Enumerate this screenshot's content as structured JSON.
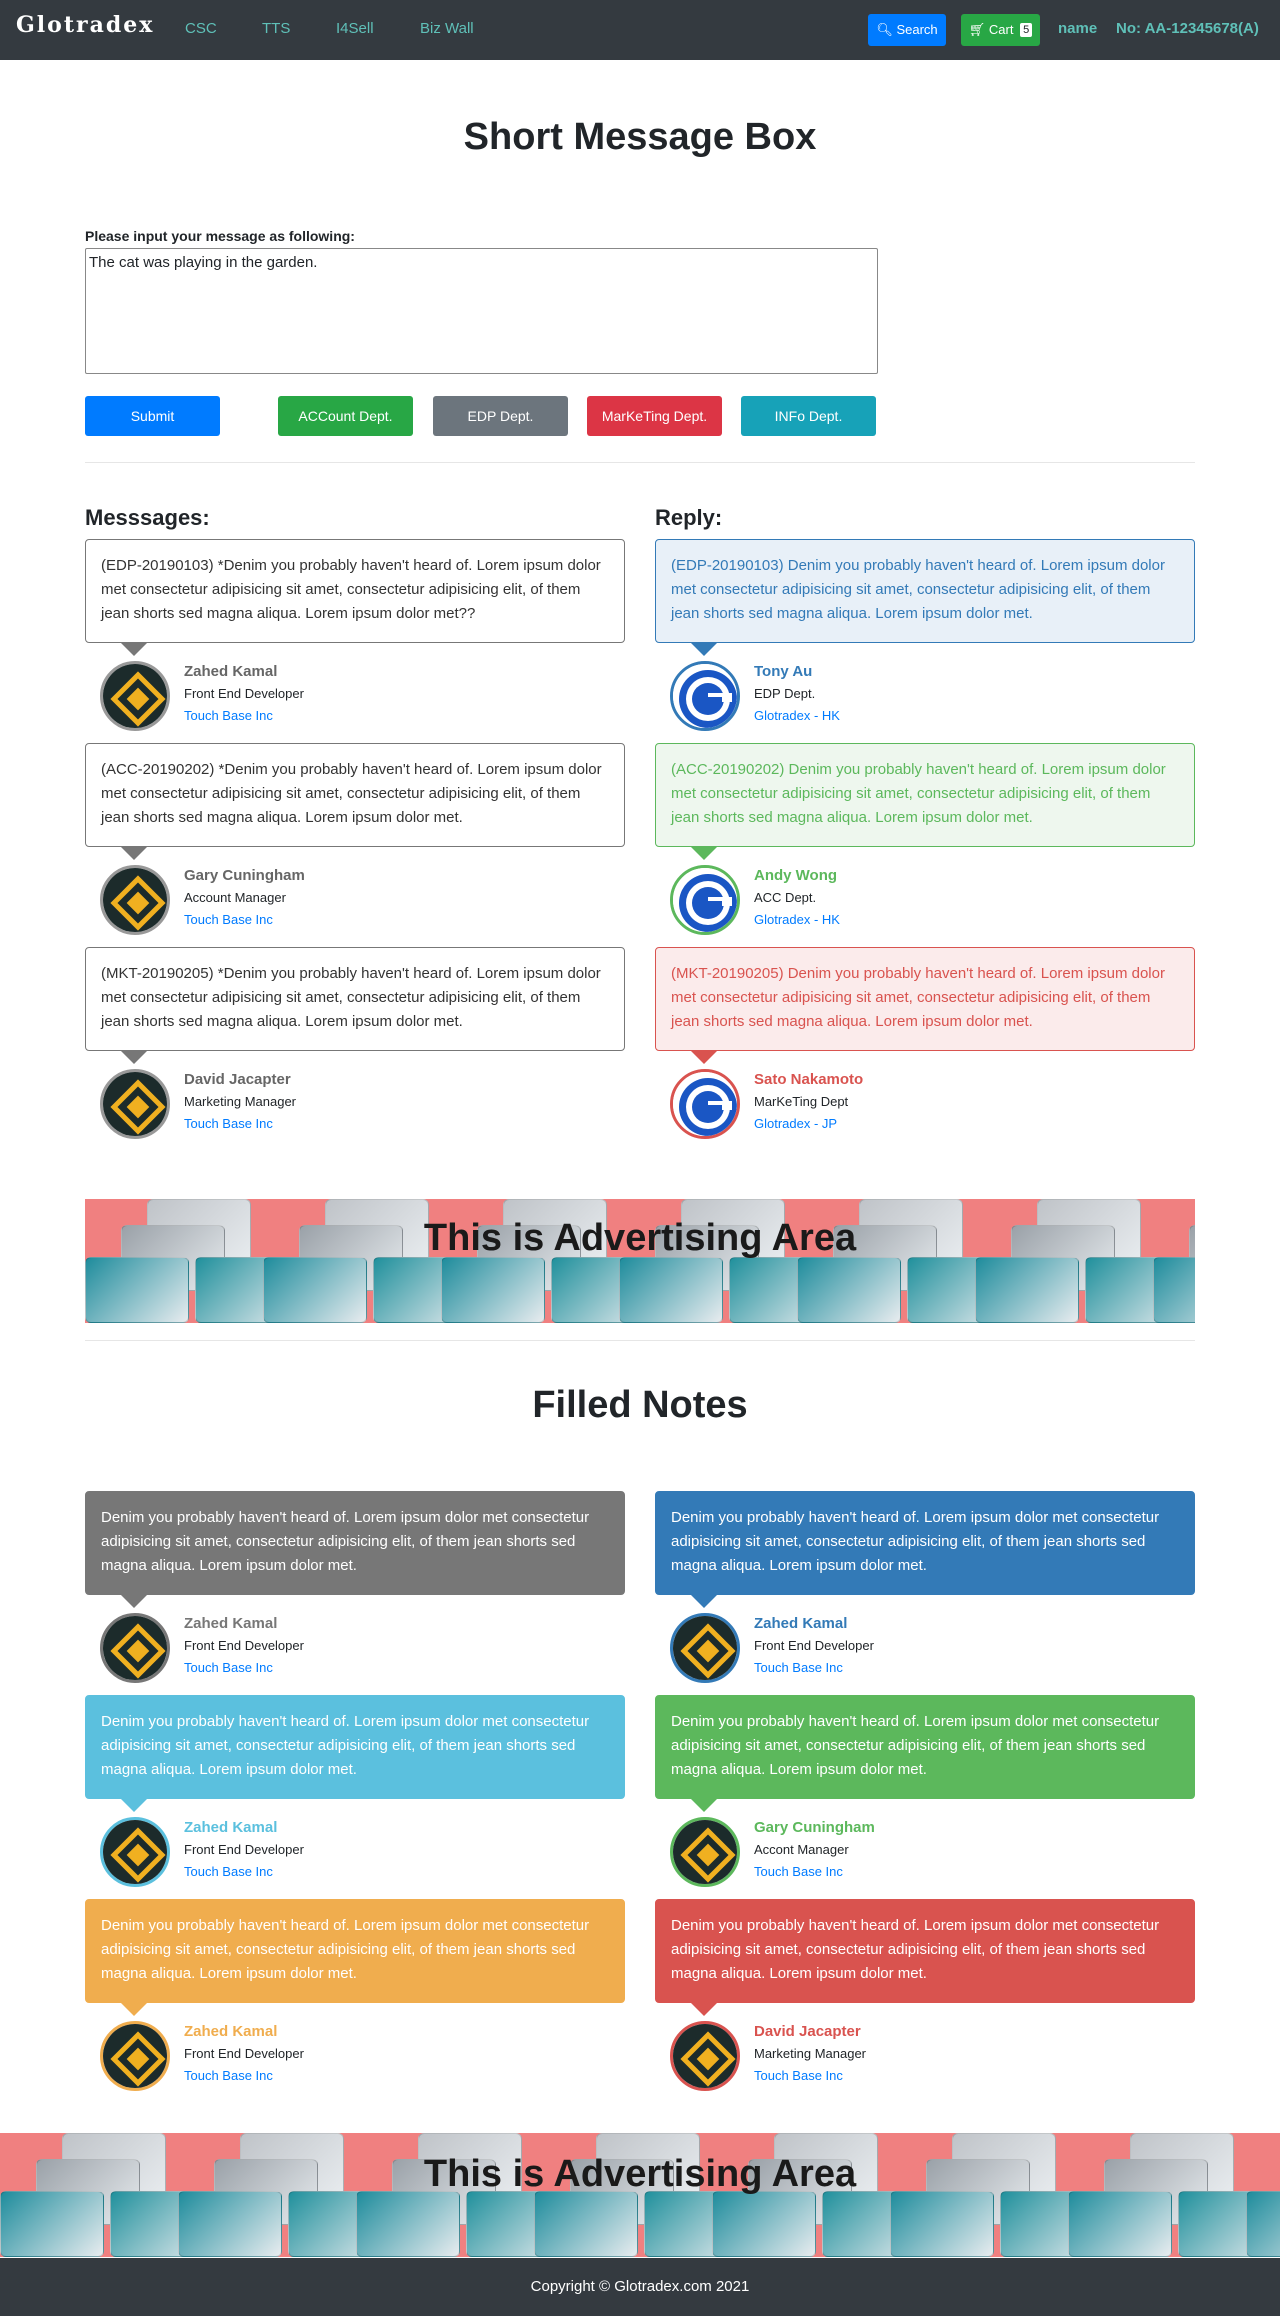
{
  "nav": {
    "brand": "Glotradex",
    "links": [
      "CSC",
      "TTS",
      "I4Sell",
      "Biz Wall"
    ],
    "search_label": "Search",
    "cart_label": "Cart",
    "cart_count": "5",
    "user_name": "name",
    "account_no": "No: AA-12345678(A)"
  },
  "page_title": "Short Message Box",
  "form": {
    "label": "Please input your message as following:",
    "message_value": "The cat was playing in the garden.",
    "submit_label": "Submit",
    "dept_buttons": [
      "ACCount Dept.",
      "EDP Dept.",
      "MarKeTing Dept.",
      "INFo Dept."
    ]
  },
  "messages_title": "Messsages:",
  "reply_title": "Reply:",
  "messages": [
    {
      "text": "(EDP-20190103) *Denim you probably haven't heard of. Lorem ipsum dolor met consectetur adipisicing sit amet, consectetur adipisicing elit, of them jean shorts sed magna aliqua. Lorem ipsum dolor met??",
      "name": "Zahed Kamal",
      "role": "Front End Developer",
      "company": "Touch Base Inc"
    },
    {
      "text": "(ACC-20190202) *Denim you probably haven't heard of. Lorem ipsum dolor met consectetur adipisicing sit amet, consectetur adipisicing elit, of them jean shorts sed magna aliqua. Lorem ipsum dolor met.",
      "name": "Gary Cuningham",
      "role": "Account Manager",
      "company": "Touch Base Inc"
    },
    {
      "text": "(MKT-20190205) *Denim you probably haven't heard of. Lorem ipsum dolor met consectetur adipisicing sit amet, consectetur adipisicing elit, of them jean shorts sed magna aliqua. Lorem ipsum dolor met.",
      "name": "David Jacapter",
      "role": "Marketing Manager",
      "company": "Touch Base Inc"
    }
  ],
  "replies": [
    {
      "text": "(EDP-20190103) Denim you probably haven't heard of. Lorem ipsum dolor met consectetur adipisicing sit amet, consectetur adipisicing elit, of them jean shorts sed magna aliqua. Lorem ipsum dolor met.",
      "name": "Tony Au",
      "role": "EDP Dept.",
      "company": "Glotradex - HK",
      "color": "#337ab7",
      "bg": "#e8f0f8"
    },
    {
      "text": "(ACC-20190202) Denim you probably haven't heard of. Lorem ipsum dolor met consectetur adipisicing sit amet, consectetur adipisicing elit, of them jean shorts sed magna aliqua. Lorem ipsum dolor met.",
      "name": "Andy Wong",
      "role": "ACC Dept.",
      "company": "Glotradex - HK",
      "color": "#5cb85c",
      "bg": "#eef7ee"
    },
    {
      "text": "(MKT-20190205) Denim you probably haven't heard of. Lorem ipsum dolor met consectetur adipisicing sit amet, consectetur adipisicing elit, of them jean shorts sed magna aliqua. Lorem ipsum dolor met.",
      "name": "Sato Nakamoto",
      "role": "MarKeTing Dept",
      "company": "Glotradex - JP",
      "color": "#d9534f",
      "bg": "#fbebeb"
    }
  ],
  "ad_title": "This is Advertising Area",
  "filled_title": "Filled Notes",
  "notes": [
    {
      "text": "Denim you probably haven't heard of. Lorem ipsum dolor met consectetur adipisicing sit amet, consectetur adipisicing elit, of them jean shorts sed magna aliqua. Lorem ipsum dolor met.",
      "name": "Zahed Kamal",
      "role": "Front End Developer",
      "company": "Touch Base Inc",
      "color": "#777777"
    },
    {
      "text": "Denim you probably haven't heard of. Lorem ipsum dolor met consectetur adipisicing sit amet, consectetur adipisicing elit, of them jean shorts sed magna aliqua. Lorem ipsum dolor met.",
      "name": "Zahed Kamal",
      "role": "Front End Developer",
      "company": "Touch Base Inc",
      "color": "#337ab7"
    },
    {
      "text": "Denim you probably haven't heard of. Lorem ipsum dolor met consectetur adipisicing sit amet, consectetur adipisicing elit, of them jean shorts sed magna aliqua. Lorem ipsum dolor met.",
      "name": "Zahed Kamal",
      "role": "Front End Developer",
      "company": "Touch Base Inc",
      "color": "#5bc0de"
    },
    {
      "text": "Denim you probably haven't heard of. Lorem ipsum dolor met consectetur adipisicing sit amet, consectetur adipisicing elit, of them jean shorts sed magna aliqua. Lorem ipsum dolor met.",
      "name": "Gary Cuningham",
      "role": "Accont Manager",
      "company": "Touch Base Inc",
      "color": "#5cb85c"
    },
    {
      "text": "Denim you probably haven't heard of. Lorem ipsum dolor met consectetur adipisicing sit amet, consectetur adipisicing elit, of them jean shorts sed magna aliqua. Lorem ipsum dolor met.",
      "name": "Zahed Kamal",
      "role": "Front End Developer",
      "company": "Touch Base Inc",
      "color": "#f0ad4e"
    },
    {
      "text": "Denim you probably haven't heard of. Lorem ipsum dolor met consectetur adipisicing sit amet, consectetur adipisicing elit, of them jean shorts sed magna aliqua. Lorem ipsum dolor met.",
      "name": "David Jacapter",
      "role": "Marketing Manager",
      "company": "Touch Base Inc",
      "color": "#d9534f"
    }
  ],
  "footer": "Copyright © Glotradex.com 2021",
  "colors": {
    "primary": "#007bff",
    "success": "#28a745",
    "secondary": "#6c757d",
    "danger": "#dc3545",
    "info": "#17a2b8",
    "navbar": "#343a40",
    "ad_bg": "#f08080"
  }
}
